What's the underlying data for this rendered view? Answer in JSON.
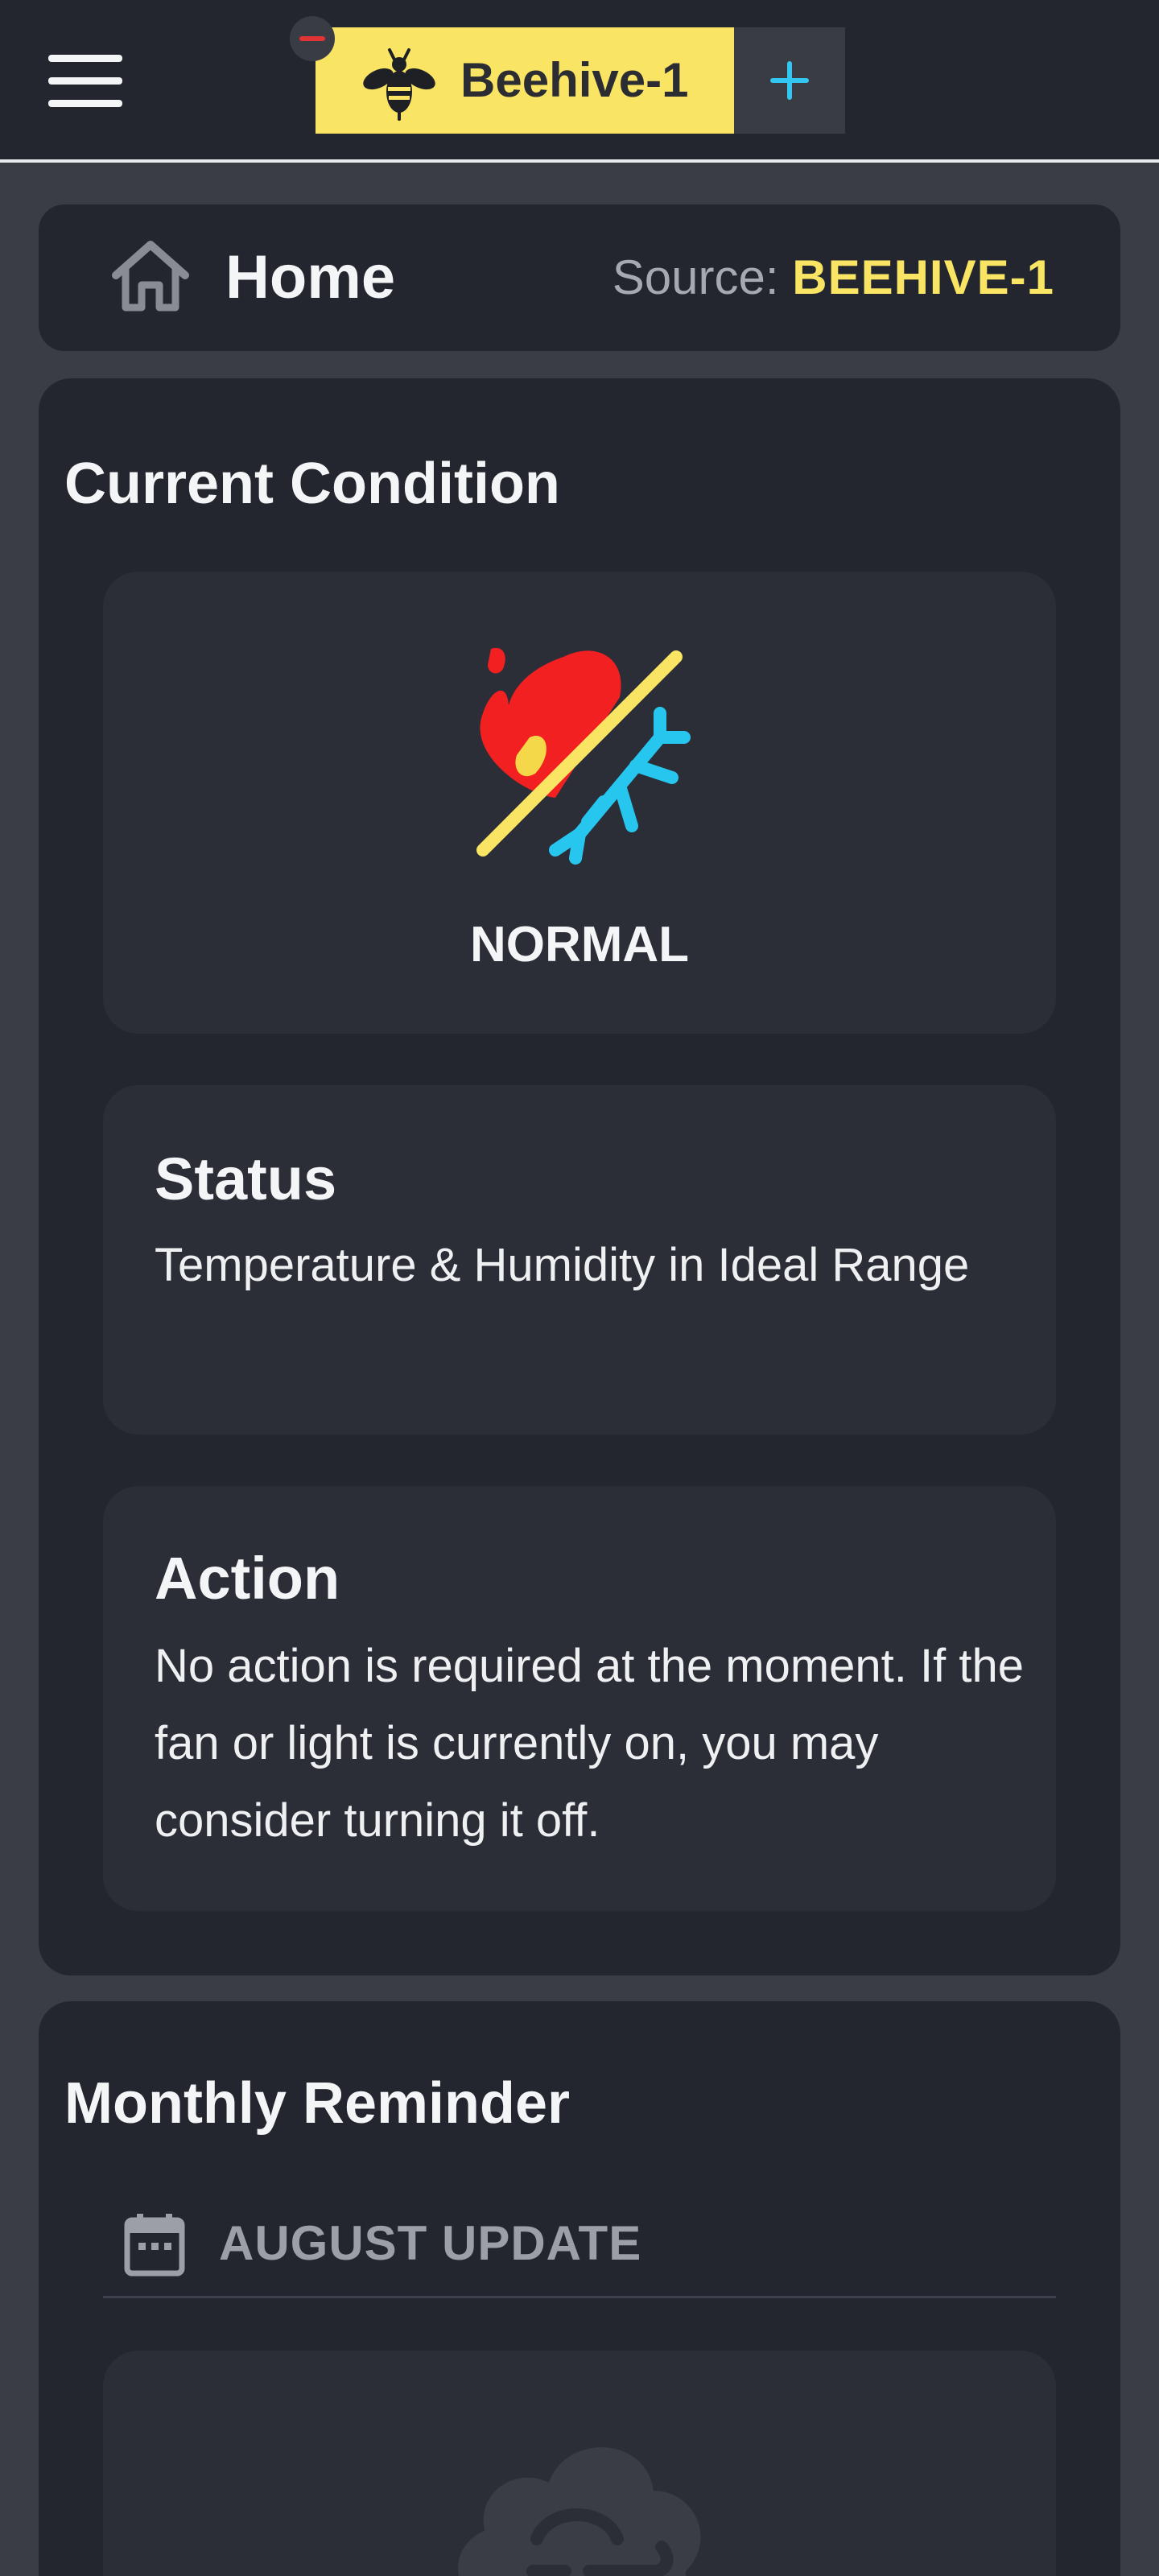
{
  "topbar": {
    "tab_label": "Beehive-1",
    "menu_icon": "hamburger-menu-icon",
    "tab_icon": "bee-icon",
    "remove_icon": "minus-badge-icon",
    "add_icon": "plus-icon",
    "accent_color": "#f9e463",
    "add_color": "#33c6f0",
    "remove_color": "#e23434"
  },
  "home": {
    "title": "Home",
    "icon": "home-icon",
    "source_label": "Source:",
    "source_value": "BEEHIVE-1"
  },
  "condition": {
    "title": "Current Condition",
    "icon": "hot-cold-icon",
    "state": "NORMAL",
    "status_heading": "Status",
    "status_text": "Temperature & Humidity in Ideal Range",
    "action_heading": "Action",
    "action_text": "No action is required at the moment. If the fan or light is currently on, you may consider turning it off."
  },
  "reminder": {
    "title": "Monthly Reminder",
    "calendar_icon": "calendar-icon",
    "update_label": "AUGUST UPDATE",
    "weather_icon": "cloud-icon"
  }
}
